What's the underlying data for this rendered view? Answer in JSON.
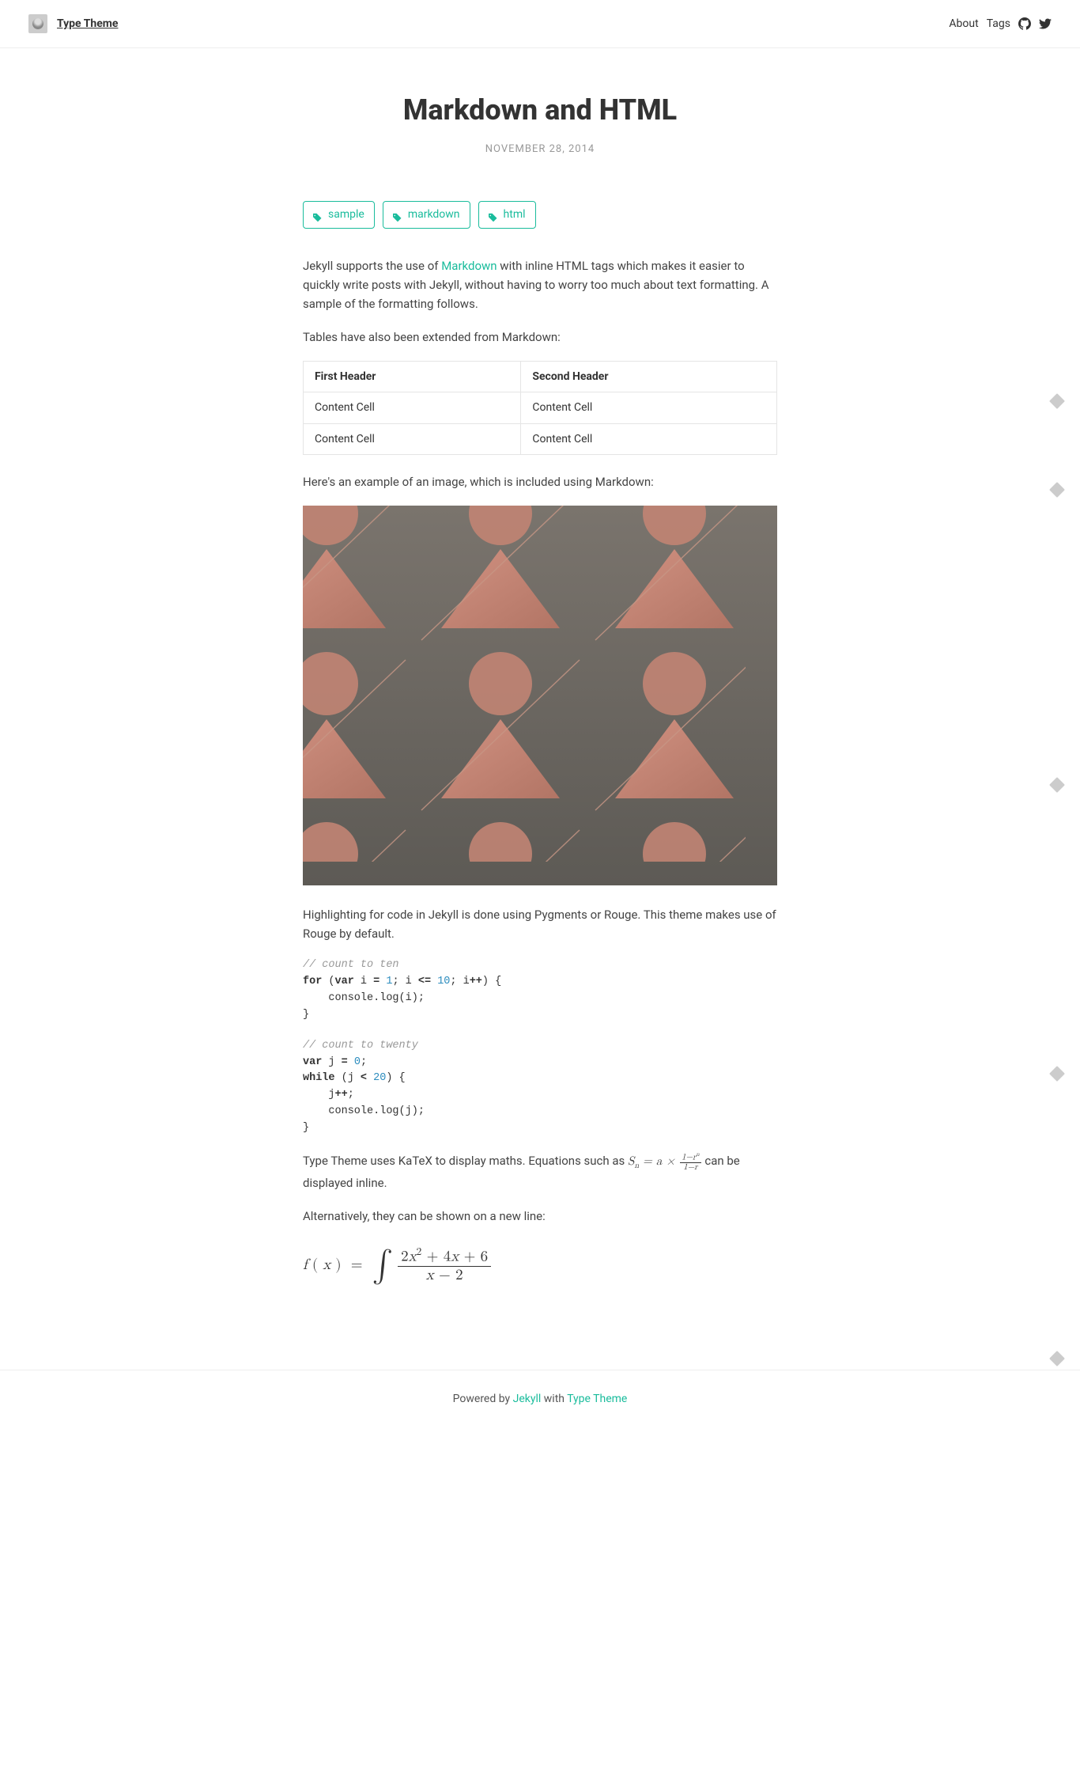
{
  "nav": {
    "site_title": "Type Theme",
    "about": "About",
    "tags": "Tags"
  },
  "post": {
    "title": "Markdown and HTML",
    "date": "NOVEMBER 28, 2014",
    "tags": [
      "sample",
      "markdown",
      "html"
    ],
    "intro_prefix": "Jekyll supports the use of ",
    "intro_link": "Markdown",
    "intro_suffix": " with inline HTML tags which makes it easier to quickly write posts with Jekyll, without having to worry too much about text formatting. A sample of the formatting follows.",
    "tables_intro": "Tables have also been extended from Markdown:",
    "table": {
      "headers": [
        "First Header",
        "Second Header"
      ],
      "rows": [
        [
          "Content Cell",
          "Content Cell"
        ],
        [
          "Content Cell",
          "Content Cell"
        ]
      ]
    },
    "image_intro": "Here's an example of an image, which is included using Markdown:",
    "highlight_intro": "Highlighting for code in Jekyll is done using Pygments or Rouge. This theme makes use of Rouge by default.",
    "code1_comment": "// count to ten",
    "code1_for": "for",
    "code1_var": "var",
    "code1_ten": "10",
    "code1_one": "1",
    "code2_comment": "// count to twenty",
    "code2_var": "var",
    "code2_while": "while",
    "code2_zero": "0",
    "code2_twenty": "20",
    "math_intro_prefix": "Type Theme uses KaTeX to display maths. Equations such as ",
    "math_intro_suffix": " can be displayed inline.",
    "math_newline": "Alternatively, they can be shown on a new line:"
  },
  "footer": {
    "prefix": "Powered by ",
    "jekyll": "Jekyll",
    "mid": " with ",
    "theme": "Type Theme"
  }
}
